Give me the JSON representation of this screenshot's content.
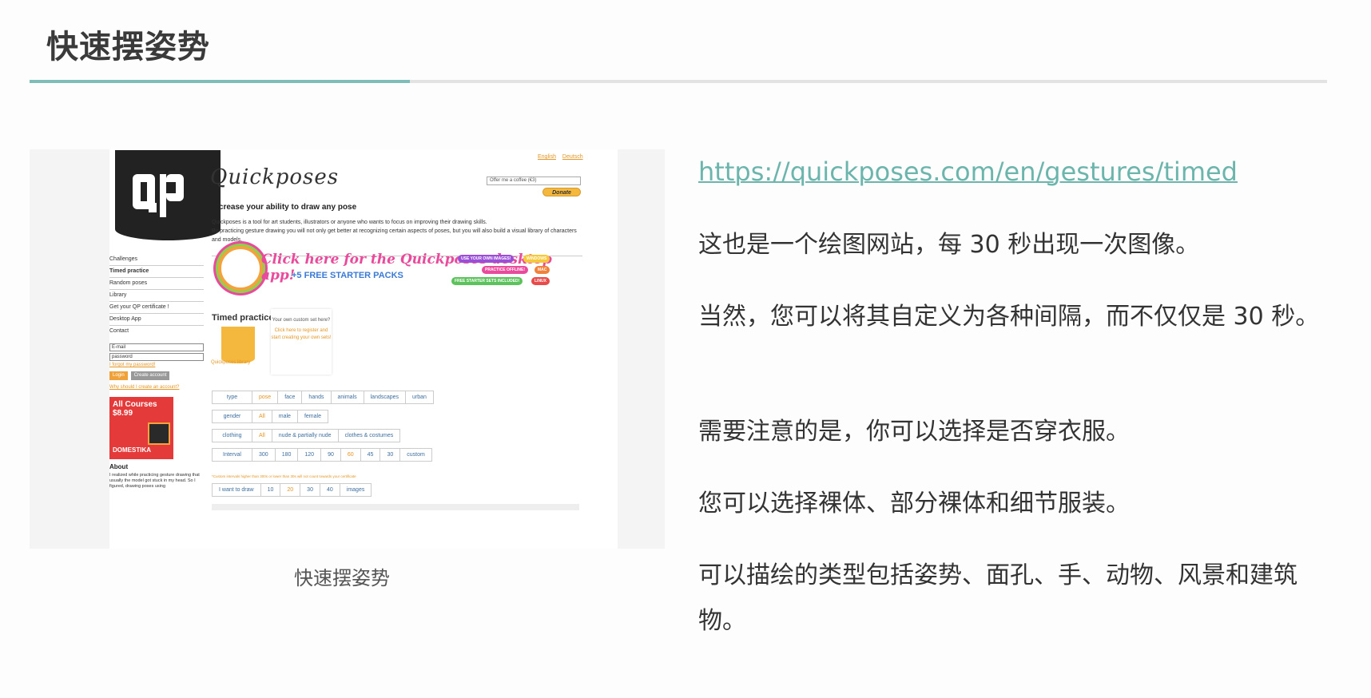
{
  "heading": "快速摆姿势",
  "figure": {
    "caption": "快速摆姿势",
    "screenshot": {
      "brand": "Quickposes",
      "lang": [
        "English",
        "Deutsch"
      ],
      "coffee_select": "Offer me a coffee (€3)",
      "donate": "Donate",
      "tagline": "Increase your ability to draw any pose",
      "desc1": "Quickposes is a tool for art students, illustrators or anyone who wants to focus on improving their drawing skills.",
      "desc2": "By practicing gesture drawing you will not only get better at recognizing certain aspects of poses, but you will also build a visual library of characters and models.",
      "nav": [
        "Challenges",
        "Timed practice",
        "Random poses",
        "Library",
        "Get your QP certificate !",
        "Desktop App",
        "Contact"
      ],
      "email_placeholder": "E-mail",
      "password_placeholder": "password",
      "forgot": "I forgot my password!",
      "login": "Login",
      "create_account": "Create account",
      "why_create": "Why should I create an account?",
      "ad_title": "All Courses $8.99",
      "ad_brand": "DOMESTIKA",
      "about_title": "About",
      "about_text": "I realized while practicing gesture drawing that usually the model got stuck in my head. So I figured, drawing poses using",
      "banner_script": "Click here for the Quickposes desktop app!",
      "banner_sub": "+5 FREE STARTER PACKS",
      "banner_pills": [
        "USE YOUR OWN IMAGES!",
        "WINDOWS",
        "PRACTICE OFFLINE!",
        "MAC",
        "FREE STARTER SETS INCLUDED!",
        "LINUX"
      ],
      "section_title": "Timed practice",
      "library_label": "Quickposes library",
      "custom_text": "Your own custom set here?",
      "custom_link": "Click here to register and start creating your own sets!",
      "filters": {
        "type": [
          "type",
          "pose",
          "face",
          "hands",
          "animals",
          "landscapes",
          "urban"
        ],
        "gender": [
          "gender",
          "All",
          "male",
          "female"
        ],
        "clothing": [
          "clothing",
          "All",
          "nude & partially nude",
          "clothes & costumes"
        ],
        "interval": [
          "Interval",
          "300",
          "180",
          "120",
          "90",
          "60",
          "45",
          "30",
          "custom"
        ],
        "count": [
          "I want to draw",
          "10",
          "20",
          "30",
          "40",
          "images"
        ]
      },
      "interval_note": "*Custom intervals higher than 300s or lower than 30s will not count towards your certificate"
    }
  },
  "article": {
    "link": "https://quickposes.com/en/gestures/timed",
    "paragraphs": [
      "这也是一个绘图网站，每 30 秒出现一次图像。",
      "当然，您可以将其自定义为各种间隔，而不仅仅是 30 秒。",
      "需要注意的是，你可以选择是否穿衣服。",
      "您可以选择裸体、部分裸体和细节服装。",
      "可以描绘的类型包括姿势、面孔、手、动物、风景和建筑物。"
    ]
  },
  "colors": {
    "accent": "#7fbdb8",
    "link": "#6cb5ac",
    "qp_orange": "#e39623"
  }
}
